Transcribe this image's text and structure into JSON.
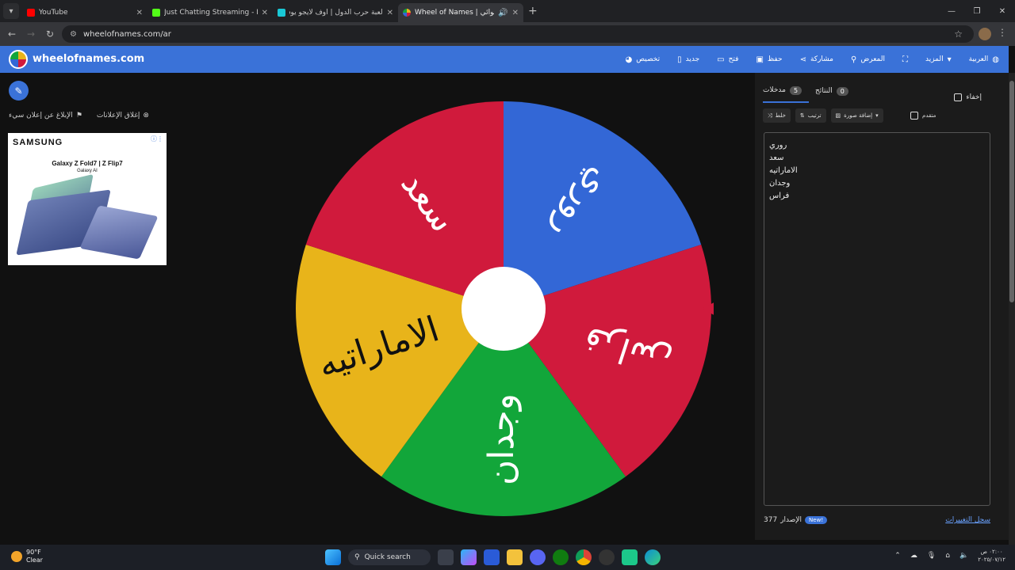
{
  "browser": {
    "tabs": [
      {
        "title": "YouTube",
        "color": "#ff0000"
      },
      {
        "title": "Just Chatting Streaming - Live",
        "color": "#53fc18"
      },
      {
        "title": "لعبة حرب الدول | اوف لايجو يوسز",
        "color": "#19c8d6"
      },
      {
        "title": "Wheel of Names | العشوائي",
        "color": "#3a72d8"
      }
    ],
    "url": "wheelofnames.com/ar"
  },
  "appbar": {
    "brand": "wheelofnames.com",
    "menu": [
      "العربية",
      "المزيد",
      "المعرض",
      "مشاركة",
      "حفظ",
      "فتح",
      "جديد",
      "تخصيص"
    ]
  },
  "left": {
    "close_ads": "إغلاق الإعلانات",
    "report_ad": "الإبلاغ عن إعلان سيء",
    "ad": {
      "brand": "SAMSUNG",
      "product": "Galaxy Z Fold7 | Z Flip7",
      "sub": "Galaxy AI"
    }
  },
  "wheel": {
    "segments": [
      {
        "label": "روري",
        "color": "#3367d6"
      },
      {
        "label": "فراس",
        "color": "#d01a3c"
      },
      {
        "label": "وجدان",
        "color": "#12a63a"
      },
      {
        "label": "الاماراتيه",
        "color": "#e8b41a"
      },
      {
        "label": "سعد",
        "color": "#d01a3c"
      }
    ],
    "pointer_color": "#d01a3c"
  },
  "panel": {
    "tab_entries": "مدخلات",
    "entries_count": "5",
    "tab_results": "النتائج",
    "results_count": "0",
    "hide": "إخفاء",
    "shuffle": "خلط",
    "sort": "ترتيب",
    "add_image": "إضافة صورة",
    "advanced": "متقدم",
    "entries": [
      "روري",
      "سعد",
      "الاماراتيه",
      "وجدان",
      "فراس"
    ],
    "version_label": "الإصدار",
    "version_number": "377",
    "new_badge": "New!",
    "changelog": "سجل التغييرات"
  },
  "taskbar": {
    "temp": "90°F",
    "weather": "Clear",
    "search": "Quick search",
    "time": "٠٢:٠٠ ص",
    "date": "٢٠٢٥/٠٧/١٢"
  }
}
